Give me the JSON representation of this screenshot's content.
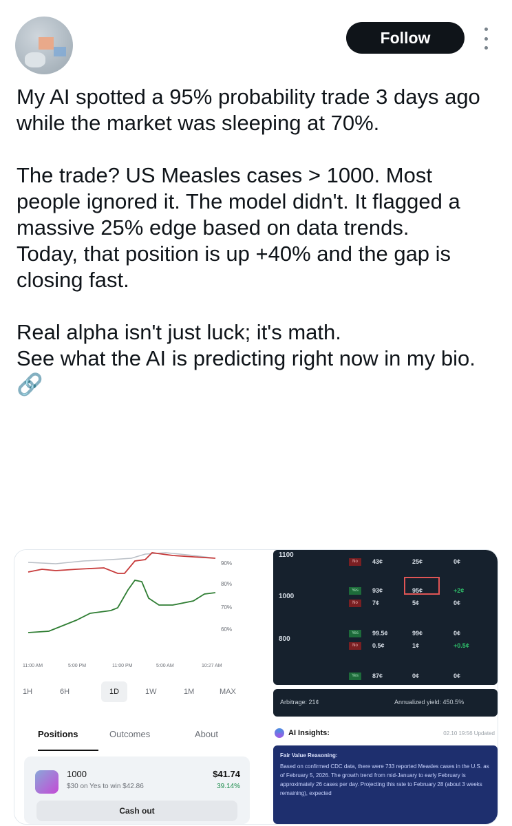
{
  "header": {
    "follow_label": "Follow"
  },
  "post": {
    "text": "My AI spotted a 95% probability trade 3 days ago while the market was sleeping at 70%.\n\nThe trade? US Measles cases > 1000. Most people ignored it. The model didn't. It flagged a massive 25% edge based on data trends.\nToday, that position is up +40% and the gap is closing fast.\n\nReal alpha isn't just luck; it's math.\nSee what the AI is predicting right now in my bio. 🔗"
  },
  "market_chart": {
    "y_ticks": [
      "90%",
      "80%",
      "70%",
      "60%"
    ],
    "x_ticks": [
      "11:00 AM",
      "5:00 PM",
      "11:00 PM",
      "5:00 AM",
      "10:27 AM"
    ],
    "timeframes": [
      "1H",
      "6H",
      "1D",
      "1W",
      "1M",
      "MAX"
    ],
    "selected_timeframe": "1D",
    "colors": {
      "top_line": "#c73a3a",
      "green_line": "#2e7d32",
      "gray_line": "#b9bfc6"
    }
  },
  "tabs": {
    "positions": "Positions",
    "outcomes": "Outcomes",
    "about": "About"
  },
  "position": {
    "title": "1000",
    "subtitle": "$30 on Yes to win $42.86",
    "value": "$41.74",
    "pct": "39.14%",
    "cash_out": "Cash out"
  },
  "order_book": {
    "strikes": [
      "1100",
      "1000",
      "800"
    ],
    "row1": [
      "43¢",
      "25¢",
      "0¢"
    ],
    "row2a": [
      "93¢",
      "95¢",
      "+2¢"
    ],
    "row2b": [
      "7¢",
      "5¢",
      "0¢"
    ],
    "row3a": [
      "99.5¢",
      "99¢",
      "0¢"
    ],
    "row3b": [
      "0.5¢",
      "1¢",
      "+0.5¢"
    ],
    "row4": [
      "87¢",
      "0¢",
      "0¢"
    ],
    "yes": "Yes",
    "no": "No"
  },
  "arbitrage": {
    "left": "Arbitrage: 21¢",
    "right": "Annualized yield: 450.5%"
  },
  "insights": {
    "title": "AI Insights:",
    "date": "02.10 19:56 Updated",
    "heading": "Fair Value Reasoning:",
    "body": "Based on confirmed CDC data, there were 733 reported Measles cases in the U.S. as of February 5, 2026. The growth trend from mid-January to early February is approximately 26 cases per day. Projecting this rate to February 28 (about 3 weeks remaining), expected"
  }
}
